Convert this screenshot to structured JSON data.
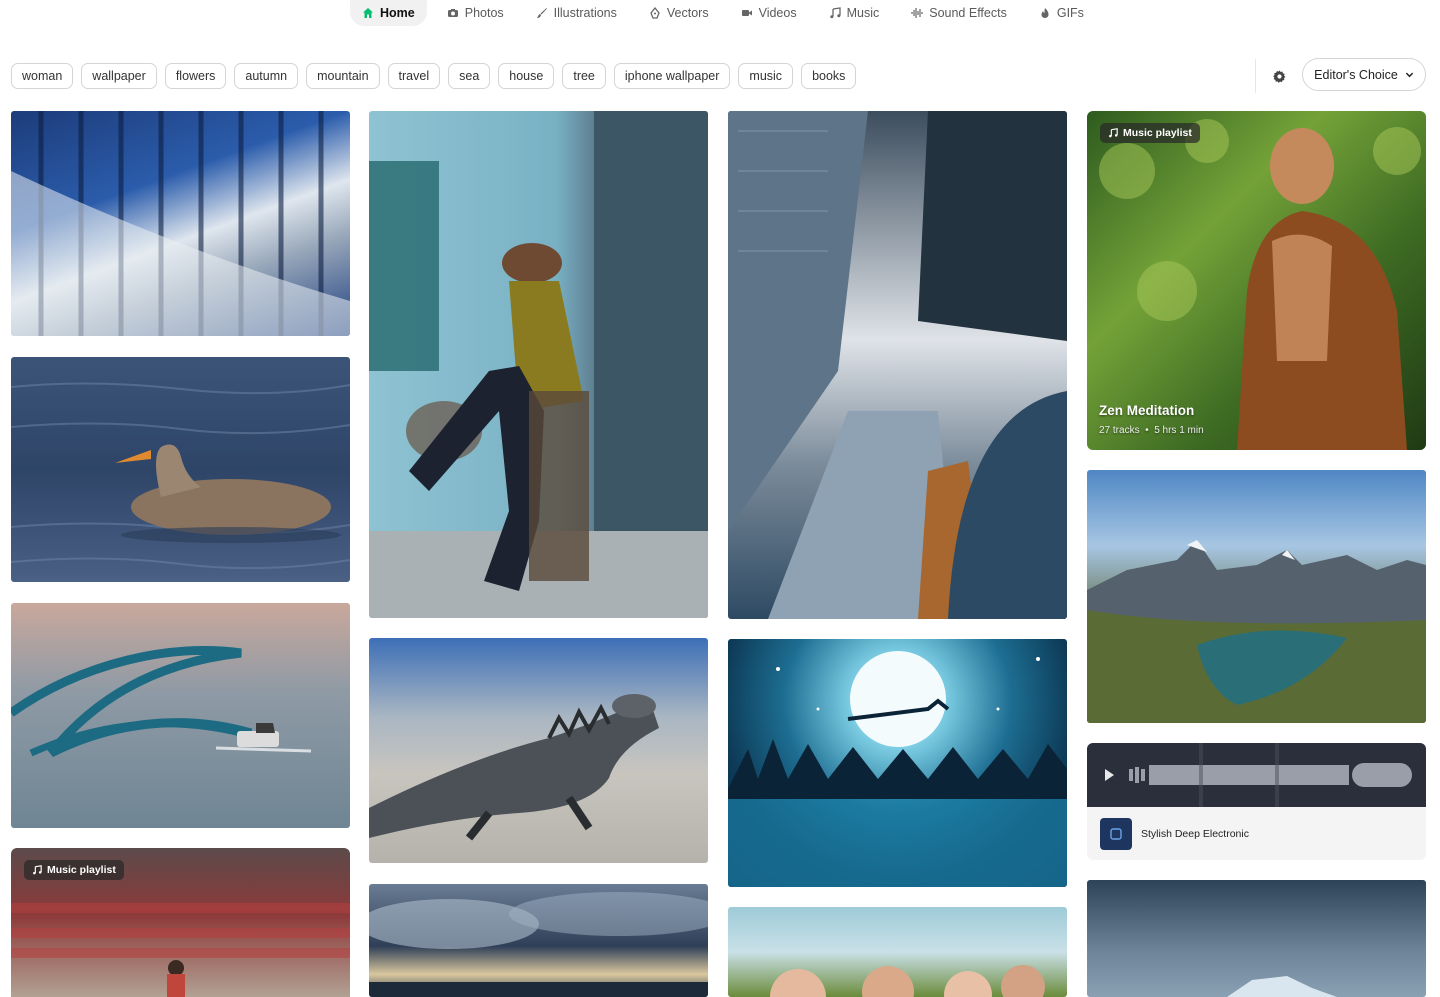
{
  "nav": [
    {
      "label": "Home",
      "icon": "home-icon",
      "active": true
    },
    {
      "label": "Photos",
      "icon": "camera-icon"
    },
    {
      "label": "Illustrations",
      "icon": "brush-icon"
    },
    {
      "label": "Vectors",
      "icon": "pen-nib-icon"
    },
    {
      "label": "Videos",
      "icon": "video-icon"
    },
    {
      "label": "Music",
      "icon": "music-note-icon"
    },
    {
      "label": "Sound Effects",
      "icon": "waveform-icon"
    },
    {
      "label": "GIFs",
      "icon": "gif-icon"
    }
  ],
  "tags": [
    "woman",
    "wallpaper",
    "flowers",
    "autumn",
    "mountain",
    "travel",
    "sea",
    "house",
    "tree",
    "iphone wallpaper",
    "music",
    "books"
  ],
  "filter": {
    "editors_choice": "Editor's Choice"
  },
  "playlists": {
    "zen": {
      "badge": "Music playlist",
      "title": "Zen Meditation",
      "tracks": "27 tracks",
      "duration": "5 hrs 1 min"
    },
    "stadium": {
      "badge": "Music playlist"
    }
  },
  "audio": {
    "title": "Stylish Deep Electronic"
  },
  "colors": {
    "accent": "#02be6e",
    "badge_bg": "#2d2d2d"
  }
}
